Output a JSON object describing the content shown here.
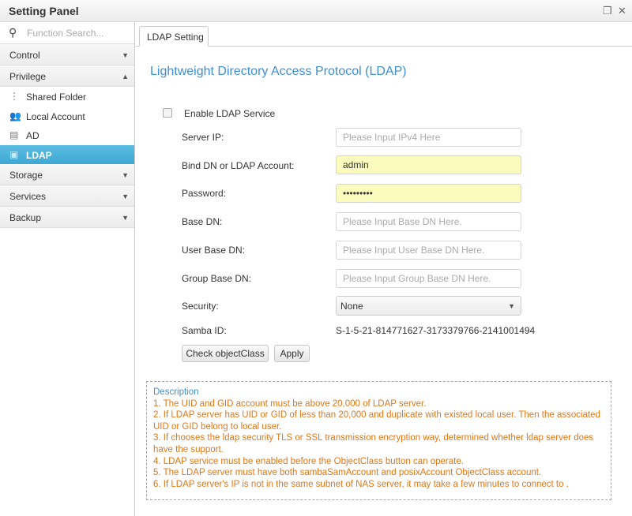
{
  "window": {
    "title": "Setting Panel",
    "restore_icon": "restore-icon",
    "close_icon": "close-icon"
  },
  "sidebar": {
    "search_placeholder": "Function Search...",
    "groups": [
      {
        "label": "Control",
        "expanded": false
      },
      {
        "label": "Privilege",
        "expanded": true,
        "items": [
          {
            "label": "Shared Folder",
            "icon": "folder-tree-icon"
          },
          {
            "label": "Local Account",
            "icon": "users-icon"
          },
          {
            "label": "AD",
            "icon": "id-card-icon"
          },
          {
            "label": "LDAP",
            "icon": "address-book-icon",
            "selected": true
          }
        ]
      },
      {
        "label": "Storage",
        "expanded": false
      },
      {
        "label": "Services",
        "expanded": false
      },
      {
        "label": "Backup",
        "expanded": false
      }
    ]
  },
  "tab": {
    "label": "LDAP Setting"
  },
  "form": {
    "title": "Lightweight Directory Access Protocol (LDAP)",
    "enable_label": "Enable LDAP Service",
    "enable_checked": false,
    "server_ip": {
      "label": "Server IP:",
      "placeholder": "Please Input IPv4 Here",
      "value": ""
    },
    "bind_dn": {
      "label": "Bind DN or LDAP Account:",
      "value": "admin"
    },
    "password": {
      "label": "Password:",
      "value": "•••••••••"
    },
    "base_dn": {
      "label": "Base DN:",
      "placeholder": "Please Input Base DN Here."
    },
    "user_base_dn": {
      "label": "User Base DN:",
      "placeholder": "Please Input User Base DN Here."
    },
    "group_base_dn": {
      "label": "Group Base DN:",
      "placeholder": "Please Input Group Base DN Here."
    },
    "security": {
      "label": "Security:",
      "value": "None"
    },
    "samba": {
      "label": "Samba ID:",
      "value": "S-1-5-21-814771627-3173379766-2141001494"
    },
    "check_button": "Check objectClass",
    "apply_button": "Apply"
  },
  "description": {
    "title": "Description",
    "lines": [
      "1. The UID and GID account must be above 20,000 of LDAP server.",
      "2. If LDAP server has UID or GID of less than 20,000 and duplicate with existed local user. Then the associated UID or GID belong to local user.",
      "3. If chooses the ldap security TLS or SSL transmission encryption way, determined whether ldap server does have the support.",
      "4. LDAP service must be enabled before the ObjectClass button can operate.",
      "5. The LDAP server must have both sambaSamAccount and posixAccount ObjectClass account.",
      "6. If LDAP server's IP is not in the same subnet of NAS server, it may take a few minutes to connect to ."
    ]
  },
  "colors": {
    "accent": "#3f8fd4",
    "selected": "#4fb3dc",
    "warning_text": "#e0781a",
    "filled_input": "#fbfbbd"
  }
}
